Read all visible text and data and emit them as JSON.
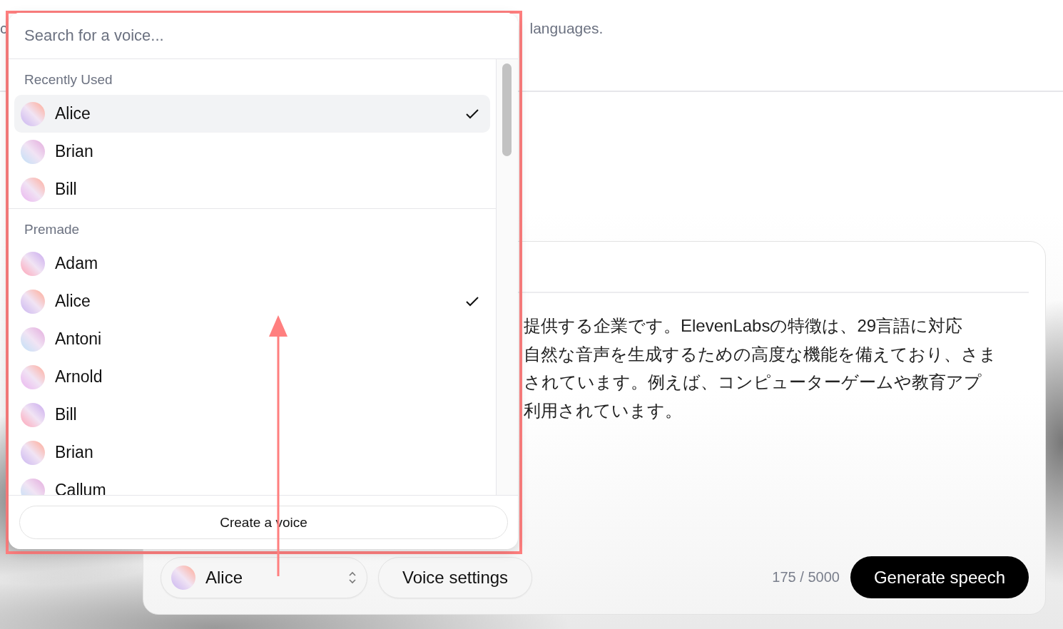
{
  "header": {
    "text_left": "c",
    "text_right": "languages."
  },
  "editor": {
    "lines": [
      "提供する企業です。ElevenLabsの特徴は、29言語に対応",
      "自然な音声を生成するための高度な機能を備えており、さま",
      "されています。例えば、コンピューターゲームや教育アプ",
      "利用されています。"
    ],
    "voice_selector": {
      "value": "Alice"
    },
    "voice_settings_button": "Voice settings",
    "char_count": "175 / 5000",
    "generate_button": "Generate speech"
  },
  "voice_dropdown": {
    "search": {
      "placeholder": "Search for a voice..."
    },
    "groups": [
      {
        "title": "Recently Used",
        "voices": [
          {
            "name": "Alice",
            "selected": true,
            "highlighted": true
          },
          {
            "name": "Brian",
            "selected": false,
            "highlighted": false
          },
          {
            "name": "Bill",
            "selected": false,
            "highlighted": false
          }
        ]
      },
      {
        "title": "Premade",
        "voices": [
          {
            "name": "Adam",
            "selected": false,
            "highlighted": false
          },
          {
            "name": "Alice",
            "selected": true,
            "highlighted": false
          },
          {
            "name": "Antoni",
            "selected": false,
            "highlighted": false
          },
          {
            "name": "Arnold",
            "selected": false,
            "highlighted": false
          },
          {
            "name": "Bill",
            "selected": false,
            "highlighted": false
          },
          {
            "name": "Brian",
            "selected": false,
            "highlighted": false
          },
          {
            "name": "Callum",
            "selected": false,
            "highlighted": false
          }
        ]
      }
    ],
    "create_button": "Create a voice"
  }
}
